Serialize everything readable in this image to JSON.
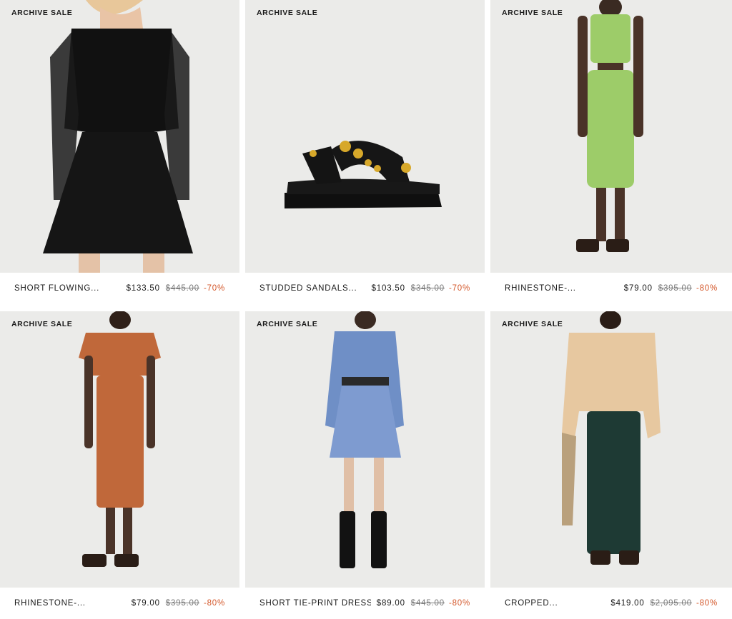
{
  "products": [
    {
      "badge": "ARCHIVE SALE",
      "name": "SHORT FLOWING...",
      "price": "$133.50",
      "old_price": "$445.00",
      "discount": "-70%"
    },
    {
      "badge": "ARCHIVE SALE",
      "name": "STUDDED SANDALS...",
      "price": "$103.50",
      "old_price": "$345.00",
      "discount": "-70%"
    },
    {
      "badge": "ARCHIVE SALE",
      "name": "RHINESTONE-...",
      "price": "$79.00",
      "old_price": "$395.00",
      "discount": "-80%"
    },
    {
      "badge": "ARCHIVE SALE",
      "name": "RHINESTONE-...",
      "price": "$79.00",
      "old_price": "$395.00",
      "discount": "-80%"
    },
    {
      "badge": "ARCHIVE SALE",
      "name": "SHORT TIE-PRINT DRESS",
      "price": "$89.00",
      "old_price": "$445.00",
      "discount": "-80%"
    },
    {
      "badge": "ARCHIVE SALE",
      "name": "CROPPED...",
      "price": "$419.00",
      "old_price": "$2,095.00",
      "discount": "-80%"
    }
  ],
  "colors": {
    "discount": "#d4582b",
    "image_bg": "#ebebe9",
    "old_price": "#7a7a7a"
  }
}
